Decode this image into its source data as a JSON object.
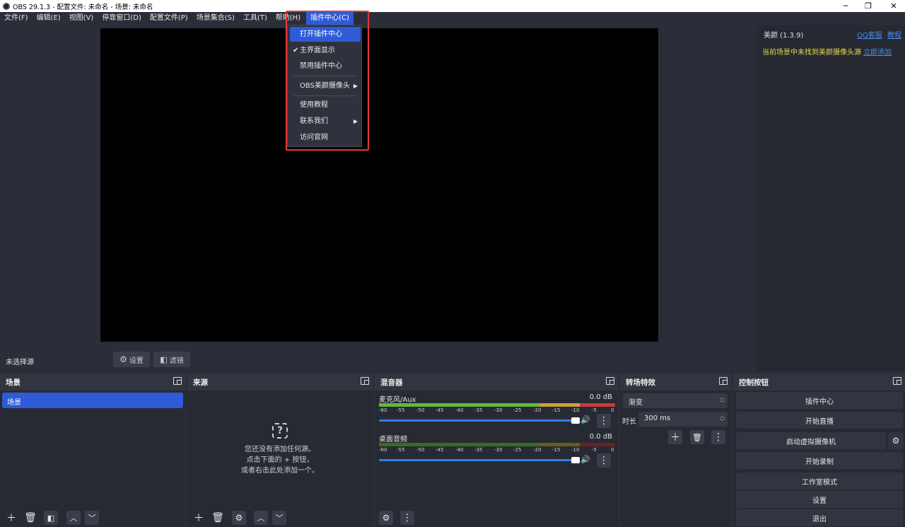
{
  "window": {
    "title": "OBS 29.1.3 - 配置文件: 未命名 - 场景: 未命名",
    "minimize": "─",
    "maximize": "❐",
    "close": "✕"
  },
  "menubar": {
    "items": [
      "文件(F)",
      "编辑(E)",
      "视图(V)",
      "停靠窗口(D)",
      "配置文件(P)",
      "场景集合(S)",
      "工具(T)",
      "帮助(H)",
      "插件中心(C)"
    ]
  },
  "dropdown": {
    "open_plugin_center": "打开插件中心",
    "main_ui_display": "主界面显示",
    "disable_plugin_center": "禁用插件中心",
    "obs_beauty_camera": "OBS美颜摄像头",
    "tutorial": "使用教程",
    "contact_us": "联系我们",
    "visit_website": "访问官网",
    "checkmark": "✔",
    "submenu_arrow": "▶"
  },
  "beauty_dock": {
    "title": "美颜 (1.3.9)",
    "qq_support": "QQ客服",
    "tutorial": "教程",
    "warning": "当前场景中未找到美颜摄像头源",
    "add_now": "立即添加"
  },
  "source_bar": {
    "no_source": "未选择源",
    "settings": "设置",
    "filters": "滤镜"
  },
  "scenes": {
    "header": "场景",
    "items": [
      "场景"
    ]
  },
  "sources": {
    "header": "来源",
    "empty_line1": "您还没有添加任何源。",
    "empty_line2": "点击下面的 + 按钮，",
    "empty_line3": "或者右击此处添加一个。"
  },
  "mixer": {
    "header": "混音器",
    "ticks": [
      "-60",
      "-55",
      "-50",
      "-45",
      "-40",
      "-35",
      "-30",
      "-25",
      "-20",
      "-15",
      "-10",
      "-5",
      "0"
    ],
    "channels": [
      {
        "name": "麦克风/Aux",
        "db": "0.0 dB",
        "volume": 1.0
      },
      {
        "name": "桌面音频",
        "db": "0.0 dB",
        "volume": 1.0
      }
    ]
  },
  "transitions": {
    "header": "转场特效",
    "type": "渐变",
    "duration_label": "时长",
    "duration": "300 ms"
  },
  "controls": {
    "header": "控制按钮",
    "plugin_center": "插件中心",
    "start_streaming": "开始直播",
    "start_virtual_cam": "启动虚拟摄像机",
    "start_recording": "开始录制",
    "studio_mode": "工作室模式",
    "settings": "设置",
    "exit": "退出"
  },
  "colors": {
    "accent": "#2f5bd6",
    "highlight_border": "#e6373a",
    "warning_text": "#e6d84a",
    "link": "#4a8ee8"
  }
}
